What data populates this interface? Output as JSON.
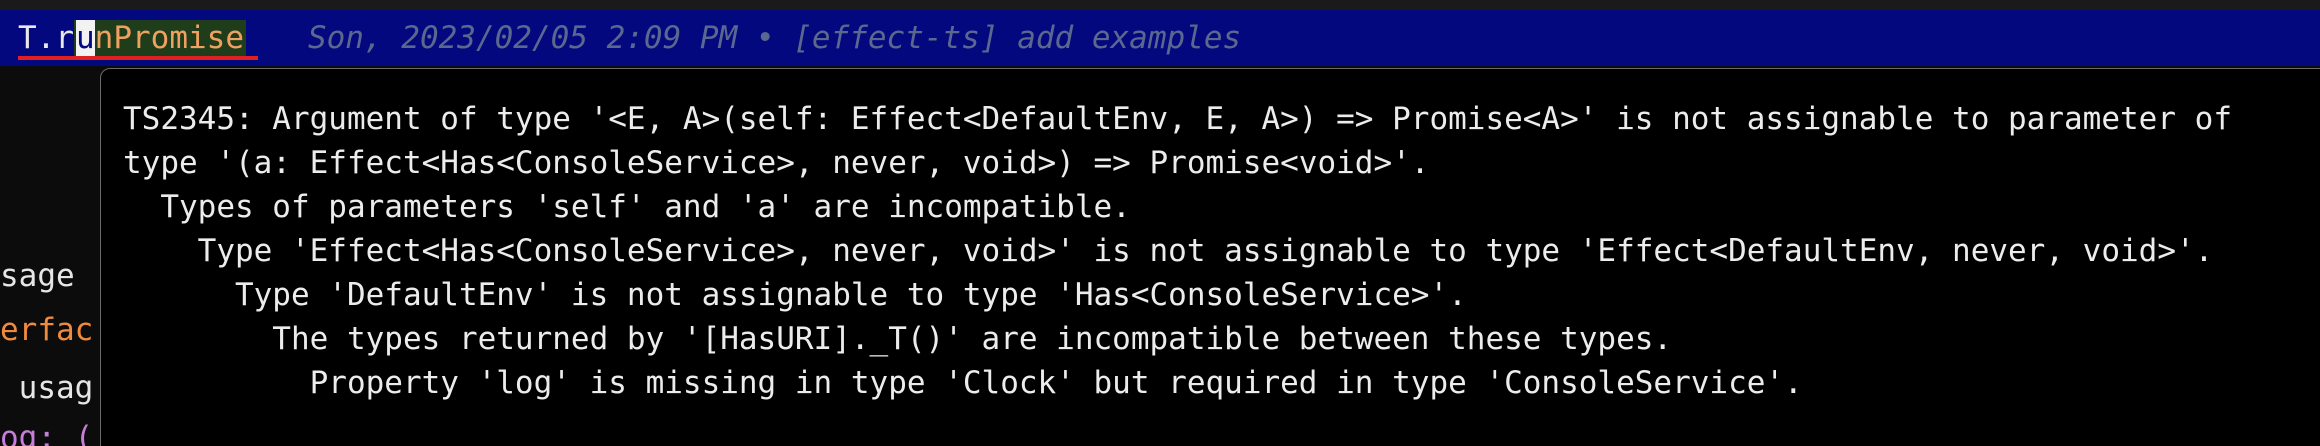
{
  "editor": {
    "code_line": {
      "prefix": "T.r",
      "cursor_char": "u",
      "rest": "nPromise",
      "blame": "Son, 2023/02/05 2:09 PM • [effect-ts] add examples"
    },
    "left_snippets": [
      {
        "text": "sage",
        "color": "#e6e6e6"
      },
      {
        "text": "erfac",
        "color": "#f08a3c"
      },
      {
        "text": " usag",
        "color": "#e6e6e6"
      },
      {
        "text": "og: (",
        "color": "#c77ddb"
      }
    ]
  },
  "hover_popup": {
    "lines": [
      "TS2345: Argument of type '<E, A>(self: Effect<DefaultEnv, E, A>) => Promise<A>' is not assignable to parameter of",
      "type '(a: Effect<Has<ConsoleService>, never, void>) => Promise<void>'.",
      "  Types of parameters 'self' and 'a' are incompatible.",
      "    Type 'Effect<Has<ConsoleService>, never, void>' is not assignable to type 'Effect<DefaultEnv, never, void>'.",
      "      Type 'DefaultEnv' is not assignable to type 'Has<ConsoleService>'.",
      "        The types returned by '[HasURI]._T()' are incompatible between these types.",
      "          Property 'log' is missing in type 'Clock' but required in type 'ConsoleService'."
    ]
  }
}
